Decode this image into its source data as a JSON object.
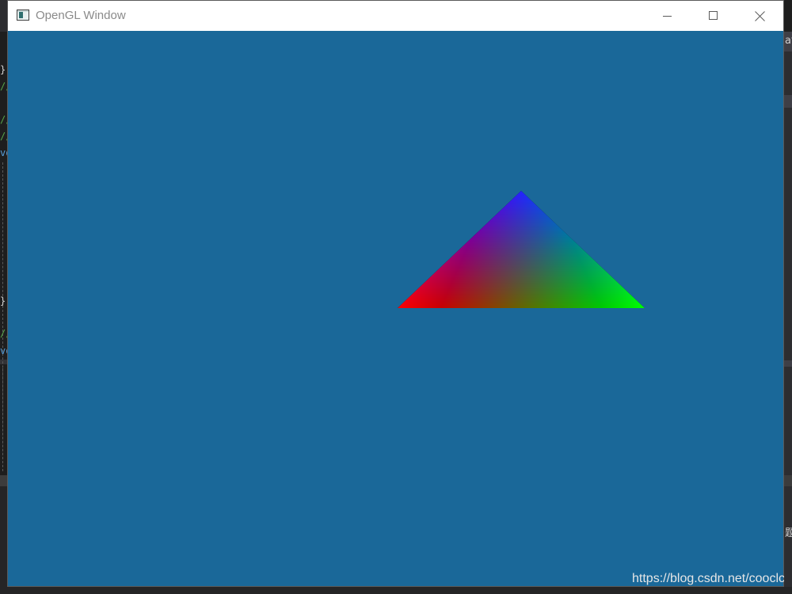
{
  "window": {
    "title": "OpenGL Window",
    "icon": "opengl-app-icon",
    "controls": {
      "minimize_icon": "minimize-icon",
      "maximize_icon": "maximize-icon",
      "close_icon": "close-icon"
    }
  },
  "canvas": {
    "clear_color": "#1a6899",
    "triangle": {
      "shape": "triangle",
      "vertex_colors": {
        "top": "#0000ff",
        "bottom_left": "#ff0000",
        "bottom_right": "#00ff00"
      }
    }
  },
  "background_ide": {
    "left_fragments": [
      {
        "text": "}",
        "color": "#d4d4d4"
      },
      {
        "text": "//",
        "color": "#57a64a"
      },
      {
        "text": "//",
        "color": "#57a64a"
      },
      {
        "text": "//",
        "color": "#57a64a"
      },
      {
        "text": "vo",
        "color": "#569cd6"
      },
      {
        "text": "}",
        "color": "#d4d4d4"
      },
      {
        "text": "//",
        "color": "#57a64a"
      },
      {
        "text": "vo",
        "color": "#569cd6"
      }
    ],
    "right_fragments": [
      {
        "text": "at"
      },
      {
        "text": "题"
      }
    ]
  },
  "watermark": {
    "text": "https://blog.csdn.net/cooclc"
  }
}
